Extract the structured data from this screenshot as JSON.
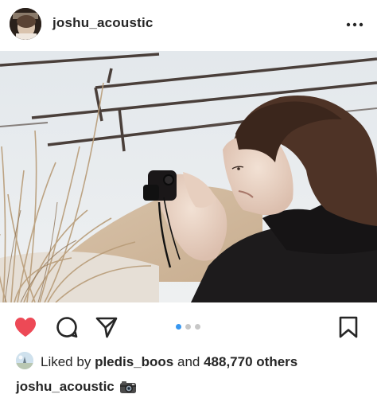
{
  "post": {
    "username": "joshu_acoustic",
    "more_icon": "more-horizontal-icon",
    "image_description": "",
    "carousel": {
      "count": 3,
      "active_index": 0
    },
    "actions": {
      "like_icon": "heart-filled-icon",
      "comment_icon": "comment-icon",
      "share_icon": "send-icon",
      "save_icon": "bookmark-icon"
    },
    "likes": {
      "prefix": "Liked by",
      "user": "pledis_boos",
      "connector": "and",
      "count": "488,770 others"
    },
    "caption": {
      "username": "joshu_acoustic",
      "emoji": "camera-emoji"
    }
  },
  "colors": {
    "like_red": "#ed4956",
    "active_dot": "#3897f0",
    "inactive_dot": "#c7c7c7",
    "text": "#262626"
  }
}
